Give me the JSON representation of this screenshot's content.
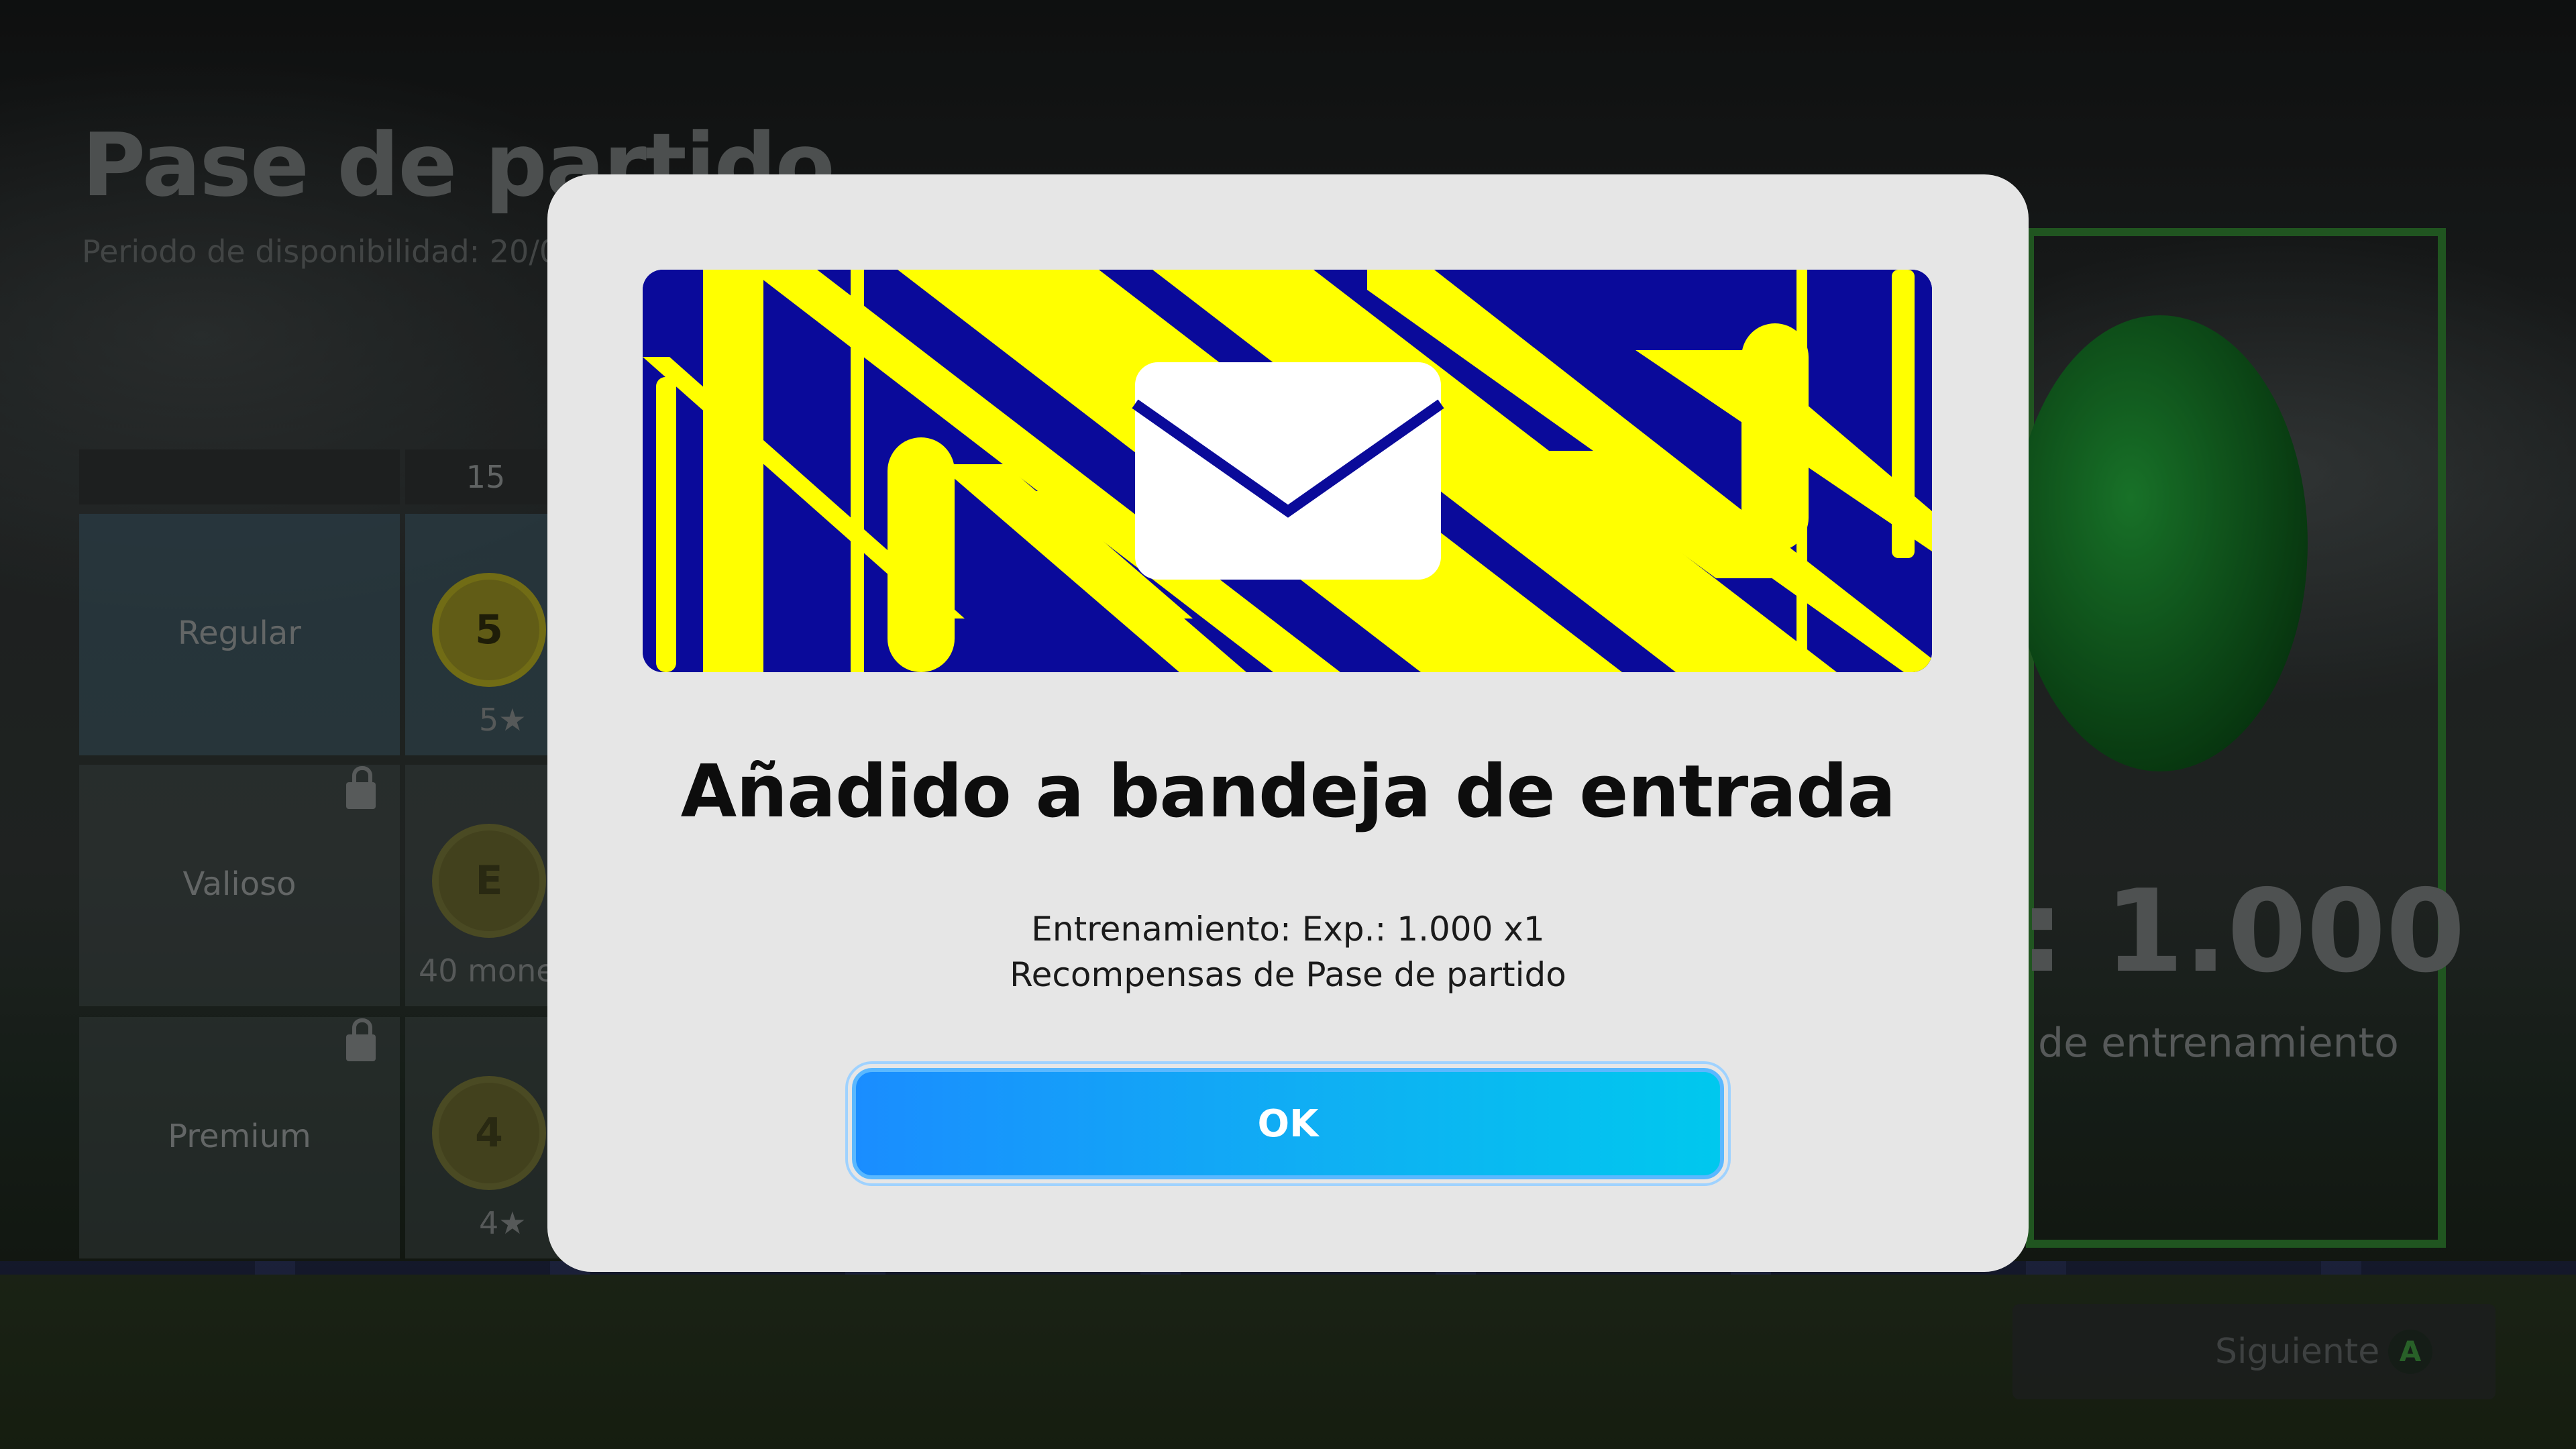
{
  "background": {
    "title": "Pase de partido",
    "period": "Periodo de disponibilidad: 20/0",
    "column_header": "15",
    "tiers": [
      {
        "label": "Regular",
        "reward": "5★",
        "coin": "5"
      },
      {
        "label": "Valioso",
        "reward": "40 mone",
        "coin": "E"
      },
      {
        "label": "Premium",
        "reward": "4★",
        "coin": "4"
      }
    ],
    "big_value": ": 1.000",
    "big_sub": "de entrenamiento",
    "next_button": "Siguiente",
    "next_key": "A"
  },
  "modal": {
    "icon": "envelope-icon",
    "title": "Añadido a bandeja de entrada",
    "line1": "Entrenamiento: Exp.: 1.000 x1",
    "line2": "Recompensas de Pase de partido",
    "ok_label": "OK"
  },
  "colors": {
    "banner_blue": "#0a0a9a",
    "banner_yellow": "#ffff00",
    "ok_gradient_start": "#1a8dff",
    "ok_gradient_end": "#00c8ee",
    "modal_bg": "#e6e6e6"
  }
}
